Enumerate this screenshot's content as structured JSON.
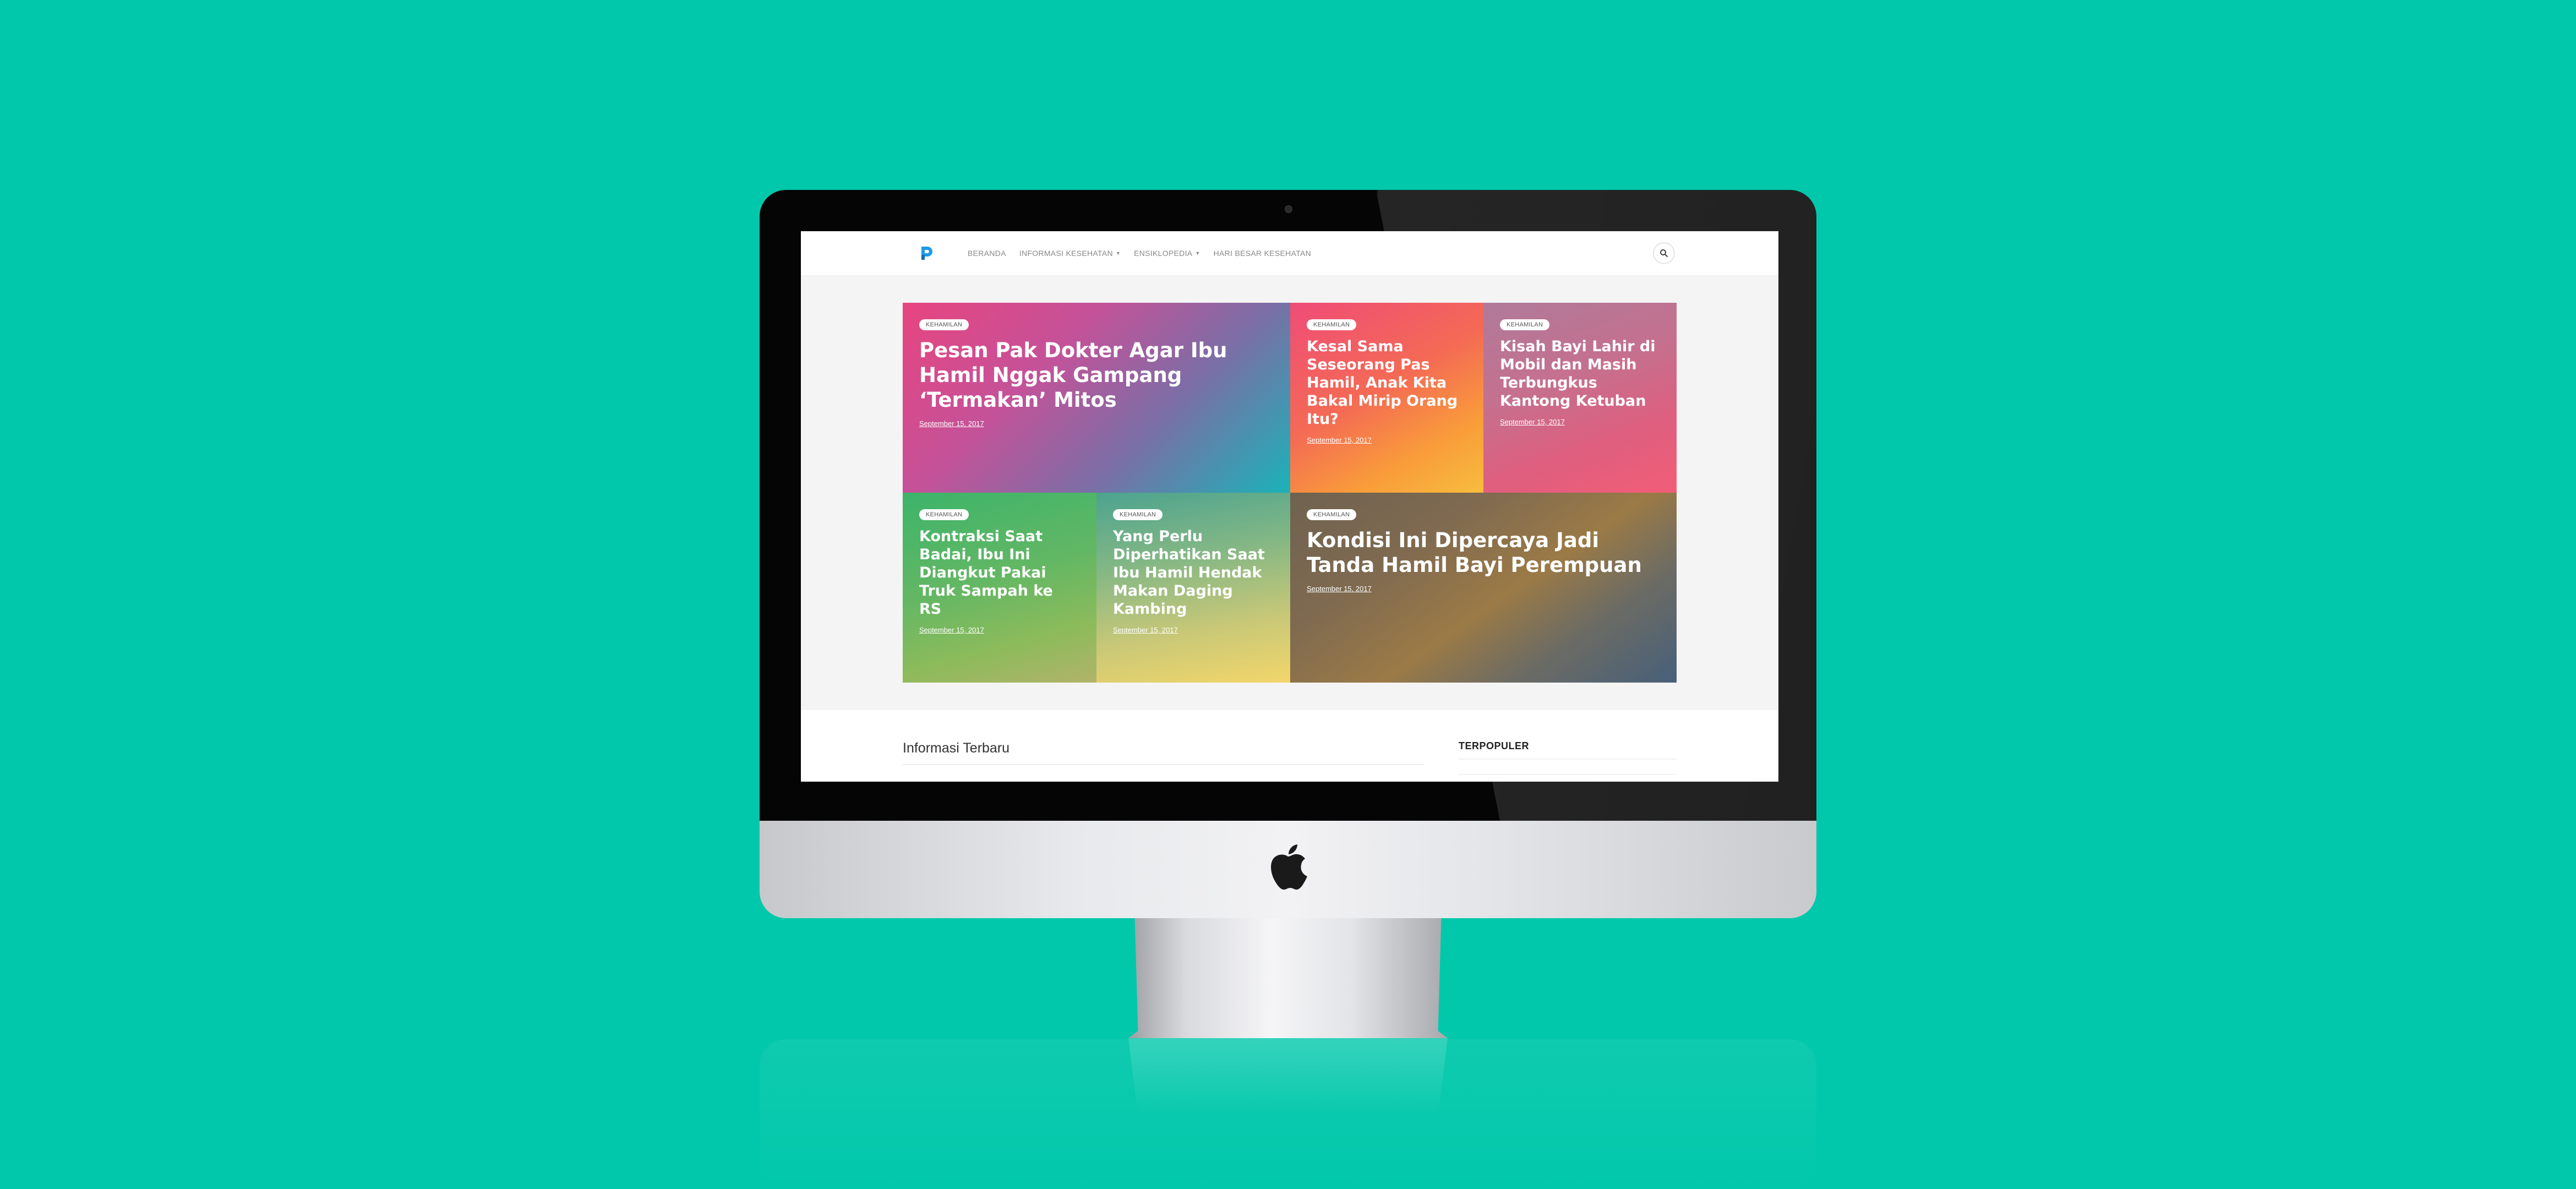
{
  "site": {
    "logo_letter": "P"
  },
  "nav": {
    "items": [
      {
        "label": "BERANDA",
        "has_dropdown": false
      },
      {
        "label": "INFORMASI KESEHATAN",
        "has_dropdown": true
      },
      {
        "label": "ENSIKLOPEDIA",
        "has_dropdown": true
      },
      {
        "label": "HARI BESAR KESEHATAN",
        "has_dropdown": false
      }
    ]
  },
  "featured": [
    {
      "category": "KEHAMILAN",
      "title": "Pesan Pak Dokter Agar Ibu Hamil Nggak Gampang ‘Termakan’ Mitos",
      "date": "September 15, 2017"
    },
    {
      "category": "KEHAMILAN",
      "title": "Kesal Sama Seseorang Pas Hamil, Anak Kita Bakal Mirip Orang Itu?",
      "date": "September 15, 2017"
    },
    {
      "category": "KEHAMILAN",
      "title": "Kisah Bayi Lahir di Mobil dan Masih Terbungkus Kantong Ketuban",
      "date": "September 15, 2017"
    },
    {
      "category": "KEHAMILAN",
      "title": "Kontraksi Saat Badai, Ibu Ini Diangkut Pakai Truk Sampah ke RS",
      "date": "September 15, 2017"
    },
    {
      "category": "KEHAMILAN",
      "title": "Yang Perlu Diperhatikan Saat Ibu Hamil Hendak Makan Daging Kambing",
      "date": "September 15, 2017"
    },
    {
      "category": "KEHAMILAN",
      "title": "Kondisi Ini Dipercaya Jadi Tanda Hamil Bayi Perempuan",
      "date": "September 15, 2017"
    }
  ],
  "main": {
    "section_title": "Informasi Terbaru"
  },
  "sidebar": {
    "title": "TERPOPULER"
  },
  "colors": {
    "background": "#02c8ab",
    "logo": "#1e9be8",
    "screen_bg": "#f4f4f4"
  }
}
